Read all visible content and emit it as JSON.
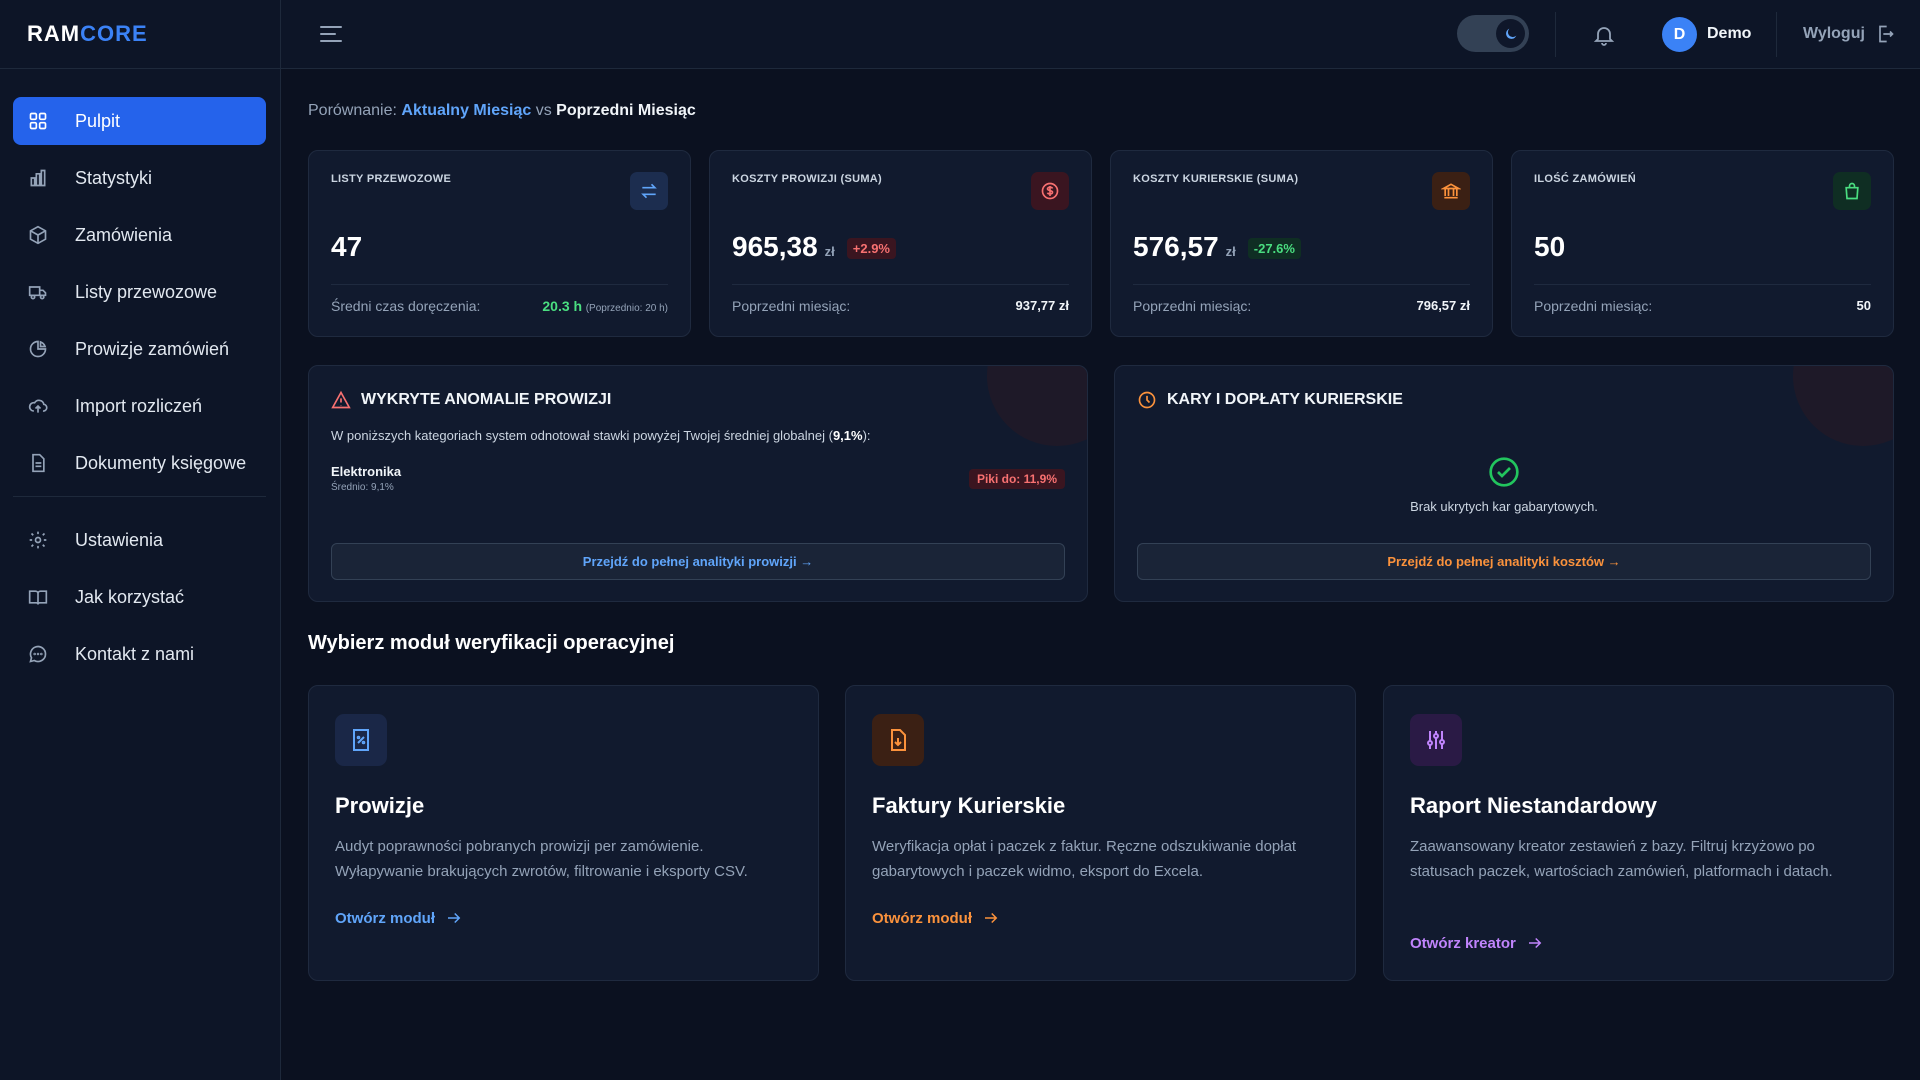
{
  "brand": {
    "part1": "RAM",
    "part2": "CORE"
  },
  "sidebar": {
    "items": [
      {
        "label": "Pulpit",
        "icon": "grid-icon"
      },
      {
        "label": "Statystyki",
        "icon": "bar-chart-icon"
      },
      {
        "label": "Zamówienia",
        "icon": "box-icon"
      },
      {
        "label": "Listy przewozowe",
        "icon": "truck-icon"
      },
      {
        "label": "Prowizje zamówień",
        "icon": "pie-chart-icon"
      },
      {
        "label": "Import rozliczeń",
        "icon": "cloud-upload-icon"
      },
      {
        "label": "Dokumenty księgowe",
        "icon": "document-icon"
      }
    ],
    "bottom_items": [
      {
        "label": "Ustawienia",
        "icon": "gear-icon"
      },
      {
        "label": "Jak korzystać",
        "icon": "book-icon"
      },
      {
        "label": "Kontakt z nami",
        "icon": "chat-icon"
      }
    ]
  },
  "topbar": {
    "avatar_letter": "D",
    "username": "Demo",
    "logout_label": "Wyloguj"
  },
  "comparison": {
    "prefix": "Porównanie:",
    "current": "Aktualny Miesiąc",
    "vs": "vs",
    "previous": "Poprzedni Miesiąc"
  },
  "stats": [
    {
      "label": "LISTY PRZEWOZOWE",
      "value": "47",
      "foot_label": "Średni czas doręczenia:",
      "foot_value": "20.3 h",
      "foot_extra": "(Poprzednio: 20 h)",
      "icon": "arrows-swap-icon",
      "accent": "#60a5fa"
    },
    {
      "label": "KOSZTY PROWIZJI (SUMA)",
      "value": "965,38",
      "unit": "zł",
      "badge": "+2.9%",
      "foot_label": "Poprzedni miesiąc:",
      "foot_value": "937,77 zł",
      "icon": "dollar-circle-icon",
      "accent": "#f87171"
    },
    {
      "label": "KOSZTY KURIERSKIE (SUMA)",
      "value": "576,57",
      "unit": "zł",
      "badge": "-27.6%",
      "foot_label": "Poprzedni miesiąc:",
      "foot_value": "796,57 zł",
      "icon": "bank-icon",
      "accent": "#fb923c"
    },
    {
      "label": "ILOŚĆ ZAMÓWIEŃ",
      "value": "50",
      "foot_label": "Poprzedni miesiąc:",
      "foot_value": "50",
      "icon": "shopping-bag-icon",
      "accent": "#4ade80"
    }
  ],
  "anomalies": {
    "title": "WYKRYTE ANOMALIE PROWIZJI",
    "desc_pre": "W poniższych kategoriach system odnotował stawki powyżej Twojej średniej globalnej (",
    "desc_value": "9,1%",
    "desc_post": "):",
    "category": "Elektronika",
    "category_avg": "Średnio: 9,1%",
    "peak": "Piki do: 11,9%",
    "button": "Przejdź do pełnej analityki prowizji →"
  },
  "penalties": {
    "title": "KARY I DOPŁATY KURIERSKIE",
    "ok_text": "Brak ukrytych kar gabarytowych.",
    "button": "Przejdź do pełnej analityki kosztów →"
  },
  "modules_title": "Wybierz moduł weryfikacji operacyjnej",
  "modules": [
    {
      "title": "Prowizje",
      "desc": "Audyt poprawności pobranych prowizji per zamówienie. Wyłapywanie brakujących zwrotów, filtrowanie i eksporty CSV.",
      "link": "Otwórz moduł",
      "accent": "#60a5fa",
      "icon": "receipt-percent-icon"
    },
    {
      "title": "Faktury Kurierskie",
      "desc": "Weryfikacja opłat i paczek z faktur. Ręczne odszukiwanie dopłat gabarytowych i paczek widmo, eksport do Excela.",
      "link": "Otwórz moduł",
      "accent": "#fb923c",
      "icon": "file-download-icon"
    },
    {
      "title": "Raport Niestandardowy",
      "desc": "Zaawansowany kreator zestawień z bazy. Filtruj krzyżowo po statusach paczek, wartościach zamówień, platformach i datach.",
      "link": "Otwórz kreator",
      "accent": "#c084fc",
      "icon": "sliders-icon"
    }
  ]
}
